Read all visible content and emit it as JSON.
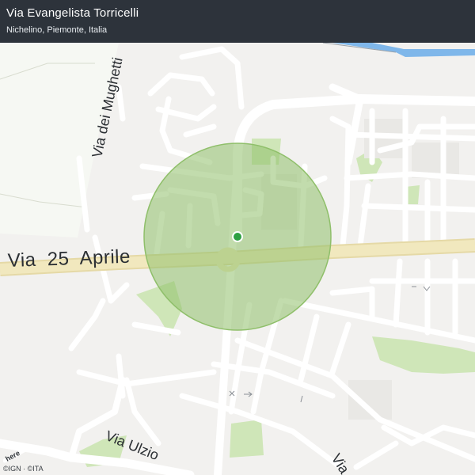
{
  "header": {
    "title": "Via Evangelista Torricelli",
    "subtitle": "Nichelino, Piemonte, Italia"
  },
  "map": {
    "street_labels": {
      "main": "Via  25  Aprile",
      "mughetti": "Via dei Mughetti",
      "ulzio": "Via Ulzio",
      "bottom_right": "Via"
    },
    "accuracy_circle_color": "#8fbf6a",
    "location_dot_color": "#2ea043",
    "water_color": "#7fb7ea"
  },
  "branding": {
    "logo_text": "here",
    "attribution": "©IGN  ·  ©ITA"
  }
}
